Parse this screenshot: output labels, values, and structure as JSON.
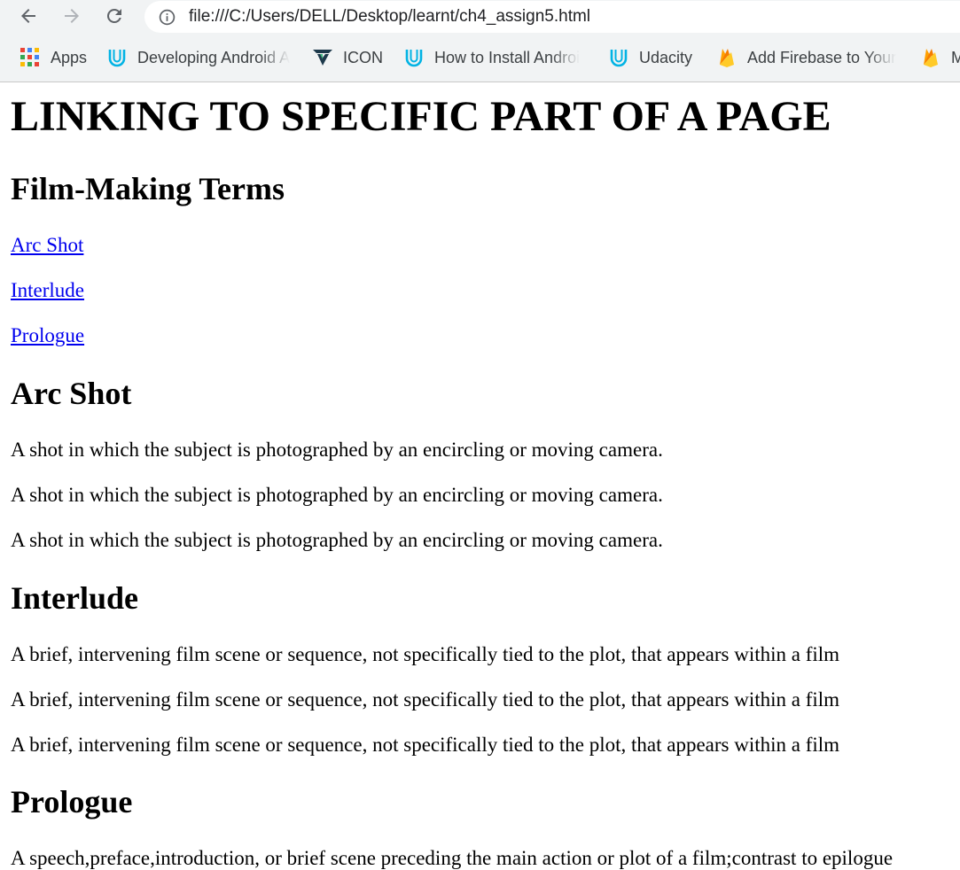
{
  "browser": {
    "url": "file:///C:/Users/DELL/Desktop/learnt/ch4_assign5.html",
    "bookmarks": [
      {
        "label": "Apps",
        "icon": "apps-grid-icon"
      },
      {
        "label": "Developing Android A",
        "icon": "udacity-icon"
      },
      {
        "label": "ICON",
        "icon": "vuetify-icon"
      },
      {
        "label": "How to Install Androi",
        "icon": "udacity-icon"
      },
      {
        "label": "Udacity",
        "icon": "udacity-icon"
      },
      {
        "label": "Add Firebase to Your",
        "icon": "firebase-icon"
      },
      {
        "label": "M",
        "icon": "firebase-icon"
      }
    ]
  },
  "page": {
    "title": "LINKING TO SPECIFIC PART OF A PAGE",
    "subtitle": "Film-Making Terms",
    "links": [
      "Arc Shot",
      "Interlude",
      "Prologue"
    ],
    "sections": [
      {
        "heading": "Arc Shot",
        "paragraphs": [
          "A shot in which the subject is photographed by an encircling or moving camera.",
          "A shot in which the subject is photographed by an encircling or moving camera.",
          "A shot in which the subject is photographed by an encircling or moving camera."
        ]
      },
      {
        "heading": "Interlude",
        "paragraphs": [
          "A brief, intervening film scene or sequence, not specifically tied to the plot, that appears within a film",
          "A brief, intervening film scene or sequence, not specifically tied to the plot, that appears within a film",
          "A brief, intervening film scene or sequence, not specifically tied to the plot, that appears within a film"
        ]
      },
      {
        "heading": "Prologue",
        "paragraphs": [
          "A speech,preface,introduction, or brief scene preceding the main action or plot of a film;contrast to epilogue"
        ]
      }
    ]
  }
}
